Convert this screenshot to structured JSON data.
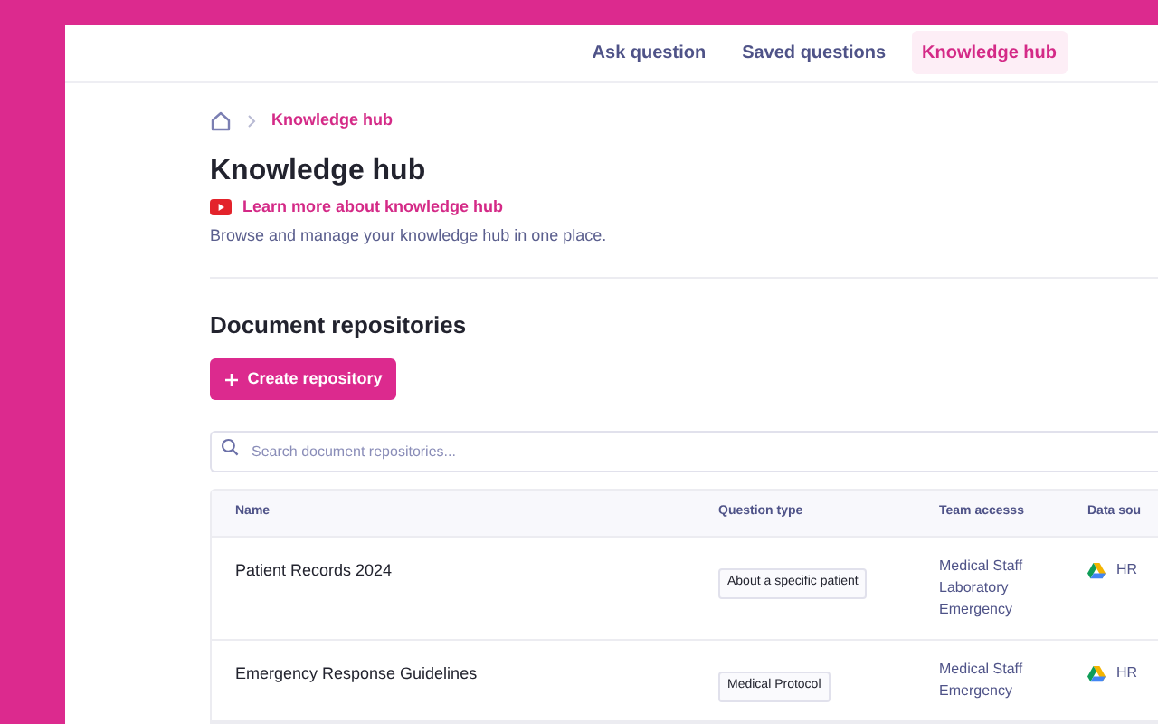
{
  "nav": [
    {
      "label": "Ask question",
      "selected": false
    },
    {
      "label": "Saved questions",
      "selected": false
    },
    {
      "label": "Knowledge hub",
      "selected": true
    }
  ],
  "breadcrumb": {
    "current": "Knowledge hub"
  },
  "page": {
    "title": "Knowledge hub",
    "video_link": "Learn more about knowledge hub",
    "description": "Browse and manage your knowledge hub in one place."
  },
  "section": {
    "title": "Document repositories",
    "create_button": "Create repository",
    "search": {
      "placeholder": "Search document repositories..."
    }
  },
  "table": {
    "columns": [
      "Name",
      "Question type",
      "Team accesss",
      "Data sou"
    ],
    "rows": [
      {
        "name": "Patient Records 2024",
        "question_type": "About a specific patient",
        "teams": [
          "Medical Staff",
          "Laboratory",
          "Emergency"
        ],
        "data_source": "HR"
      },
      {
        "name": "Emergency Response Guidelines",
        "question_type": "Medical Protocol",
        "teams": [
          "Medical Staff",
          "Emergency"
        ],
        "data_source": "HR"
      }
    ]
  }
}
